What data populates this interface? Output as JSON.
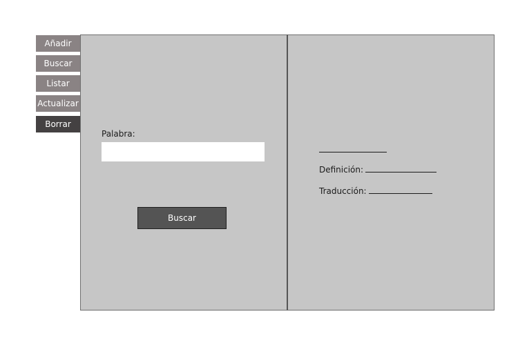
{
  "sidebar": {
    "items": [
      {
        "label": "Añadir",
        "active": false
      },
      {
        "label": "Buscar",
        "active": false
      },
      {
        "label": "Listar",
        "active": false
      },
      {
        "label": "Actualizar",
        "active": false
      },
      {
        "label": "Borrar",
        "active": true
      }
    ]
  },
  "search_form": {
    "word_label": "Palabra:",
    "word_value": "",
    "submit_label": "Buscar"
  },
  "result": {
    "definition_label": "Definición:",
    "translation_label": "Traducción:"
  },
  "colors": {
    "nav_default": "#8a8384",
    "nav_active": "#444142",
    "panel_bg": "#c6c6c6",
    "button_bg": "#545454"
  }
}
